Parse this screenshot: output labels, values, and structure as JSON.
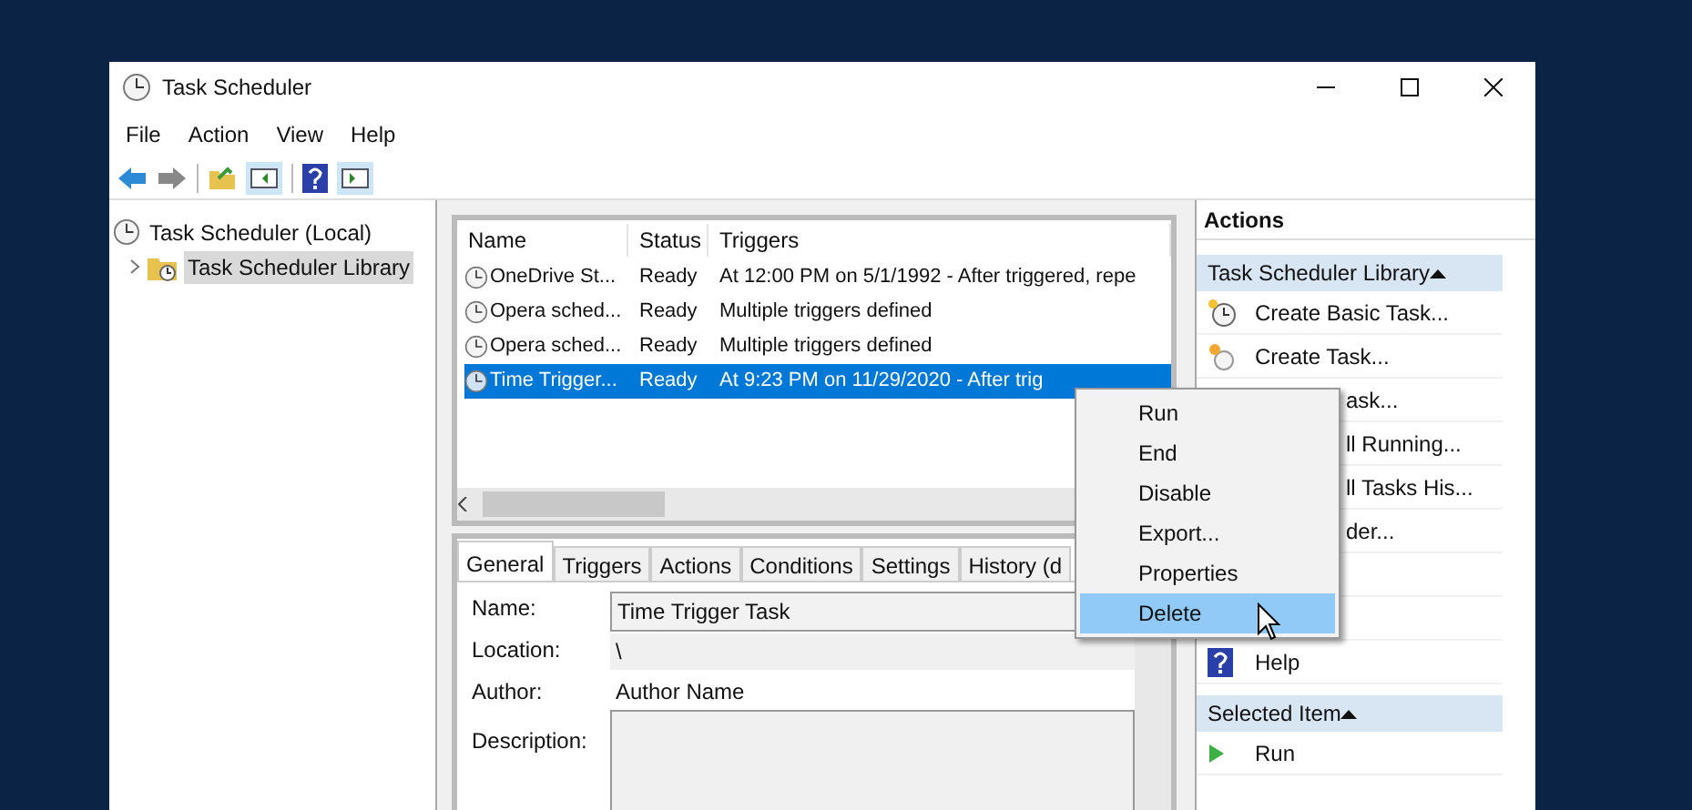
{
  "window": {
    "title": "Task Scheduler"
  },
  "menu_bar": [
    "File",
    "Action",
    "View",
    "Help"
  ],
  "tree": [
    {
      "label": "Task Scheduler (Local)",
      "selected": false,
      "children": [
        {
          "label": "Task Scheduler Library",
          "expanded": false,
          "selected": true
        }
      ]
    }
  ],
  "task_list": {
    "columns": [
      "Name",
      "Status",
      "Triggers"
    ],
    "rows": [
      {
        "name": "OneDrive St...",
        "status": "Ready",
        "triggers": "At 12:00 PM on 5/1/1992 - After triggered, repe",
        "selected": false
      },
      {
        "name": "Opera sched...",
        "status": "Ready",
        "triggers": "Multiple triggers defined",
        "selected": false
      },
      {
        "name": "Opera sched...",
        "status": "Ready",
        "triggers": "Multiple triggers defined",
        "selected": false
      },
      {
        "name": "Time Trigger...",
        "status": "Ready",
        "triggers": "At 9:23 PM on 11/29/2020 - After trig",
        "selected": true
      }
    ]
  },
  "details": {
    "tabs": [
      {
        "label": "General",
        "selected": true
      },
      {
        "label": "Triggers",
        "selected": false
      },
      {
        "label": "Actions",
        "selected": false
      },
      {
        "label": "Conditions",
        "selected": false
      },
      {
        "label": "Settings",
        "selected": false
      },
      {
        "label": "History (d",
        "selected": false
      }
    ],
    "fields": [
      {
        "kind": "field",
        "label": "Name:",
        "value": "Time Trigger Task"
      },
      {
        "kind": "shaded",
        "label": "Location:",
        "value": "\\"
      },
      {
        "kind": "text",
        "label": "Author:",
        "value": "Author Name"
      },
      {
        "kind": "area",
        "label": "Description:"
      }
    ]
  },
  "actions": {
    "title": "Actions",
    "sections": [
      {
        "title": "Task Scheduler Library",
        "items": [
          {
            "kind": "basic",
            "label": "Create Basic Task..."
          },
          {
            "kind": "create",
            "label": "Create Task..."
          },
          {
            "kind": "covered",
            "label": "ask..."
          },
          {
            "kind": "covered",
            "label": "ll Running..."
          },
          {
            "kind": "covered",
            "label": "ll Tasks His..."
          },
          {
            "kind": "covered",
            "label": "der..."
          },
          {
            "kind": "submenu"
          },
          {
            "kind": "covered"
          },
          {
            "kind": "help",
            "label": "Help"
          }
        ]
      },
      {
        "title": "Selected Item",
        "items": [
          {
            "kind": "run",
            "label": "Run"
          }
        ]
      }
    ]
  },
  "context_menu": [
    {
      "label": "Run",
      "selected": false
    },
    {
      "label": "End",
      "selected": false
    },
    {
      "label": "Disable",
      "selected": false
    },
    {
      "label": "Export...",
      "selected": false
    },
    {
      "label": "Properties",
      "selected": false
    },
    {
      "label": "Delete",
      "selected": true
    }
  ]
}
